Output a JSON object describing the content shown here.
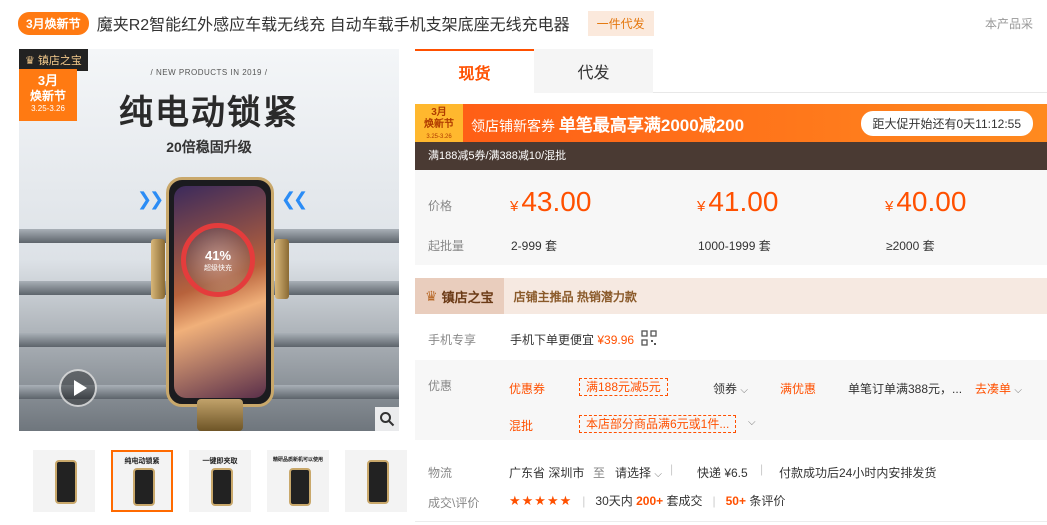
{
  "header": {
    "festival_badge": "3月焕新节",
    "title": "魔夹R2智能红外感应车载无线充 自动车载手机支架底座无线充电器",
    "dropship_tag": "一件代发",
    "right_cut": "本产品采"
  },
  "gallery": {
    "shop_tag": "镇店之宝",
    "fest_month": "3月",
    "fest_name": "焕新节",
    "fest_date": "3.25-3.26",
    "new_products": "/ NEW PRODUCTS IN 2019 /",
    "headline": "纯电动锁紧",
    "subheadline": "20倍稳固升级",
    "charge_percent": "41%",
    "charge_label": "超级快充",
    "thumbs": [
      {
        "label": ""
      },
      {
        "label": "纯电动锁紧"
      },
      {
        "label": "一键即夹取"
      },
      {
        "label": "精研品质新机可以使用"
      },
      {
        "label": ""
      }
    ]
  },
  "tabs": [
    {
      "label": "现货"
    },
    {
      "label": "代发"
    }
  ],
  "promo": {
    "fest_month": "3月",
    "fest_name": "焕新节",
    "fest_date": "3.25-3.26",
    "coupon_prefix": "领店铺新客券 ",
    "coupon_main": "单笔最高享满2000减200",
    "countdown": "距大促开始还有0天11:12:55",
    "sub": "满188减5券/满388减10/混批"
  },
  "price": {
    "label": "价格",
    "qty_label": "起批量",
    "currency": "¥",
    "tiers": [
      {
        "price": "43.00",
        "qty": "2-999 套"
      },
      {
        "price": "41.00",
        "qty": "1000-1999 套"
      },
      {
        "price": "40.00",
        "qty": "≥2000 套"
      }
    ]
  },
  "shop_bar": {
    "title": "镇店之宝",
    "desc": "店铺主推品  热销潜力款"
  },
  "mobile": {
    "label": "手机专享",
    "text": "手机下单更便宜",
    "price": "¥39.96"
  },
  "offers": {
    "label": "优惠",
    "coupon_label": "优惠券",
    "coupon_value": "满188元减5元",
    "claim": "领券",
    "full_label": "满优惠",
    "full_text": "单笔订单满388元，...",
    "go_order": "去凑单",
    "mixed_label": "混批",
    "mixed_value": "本店部分商品满6元或1件..."
  },
  "shipping": {
    "label": "物流",
    "from": "广东省 深圳市",
    "to": "至",
    "select": "请选择",
    "express": "快递 ¥6.5",
    "note": "付款成功后24小时内安排发货"
  },
  "rating": {
    "label": "成交\\评价",
    "stars": "★★★★★",
    "sales_prefix": "30天内",
    "sales_count": "200+",
    "sales_suffix": "套成交",
    "review_count": "50+",
    "review_suffix": "条评价"
  },
  "colors": {
    "accent": "#ff5000",
    "festival": "#ff7a12"
  }
}
